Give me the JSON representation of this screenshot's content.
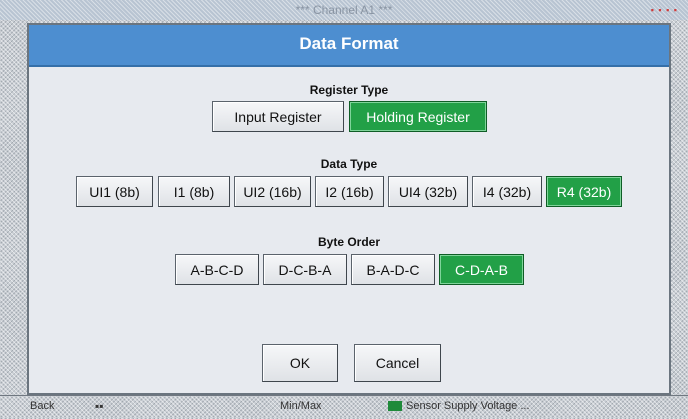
{
  "background": {
    "title": "*** Channel A1 ***",
    "corner_marks": "▪ ▪ ▪ ▪",
    "back_label": "Back",
    "minmax_label": "Min/Max",
    "status_label": "Sensor Supply Voltage ..."
  },
  "dialog": {
    "title": "Data Format",
    "register_type": {
      "label": "Register Type",
      "options": [
        "Input Register",
        "Holding Register"
      ],
      "selected": "Holding Register"
    },
    "data_type": {
      "label": "Data Type",
      "options": [
        "UI1 (8b)",
        "I1 (8b)",
        "UI2 (16b)",
        "I2 (16b)",
        "UI4 (32b)",
        "I4 (32b)",
        "R4 (32b)"
      ],
      "selected": "R4 (32b)"
    },
    "byte_order": {
      "label": "Byte Order",
      "options": [
        "A-B-C-D",
        "D-C-B-A",
        "B-A-D-C",
        "C-D-A-B"
      ],
      "selected": "C-D-A-B"
    },
    "ok_label": "OK",
    "cancel_label": "Cancel"
  },
  "colors": {
    "title_bar": "#4d8ed0",
    "selected": "#22a047",
    "dialog_bg": "#e7eaef"
  }
}
